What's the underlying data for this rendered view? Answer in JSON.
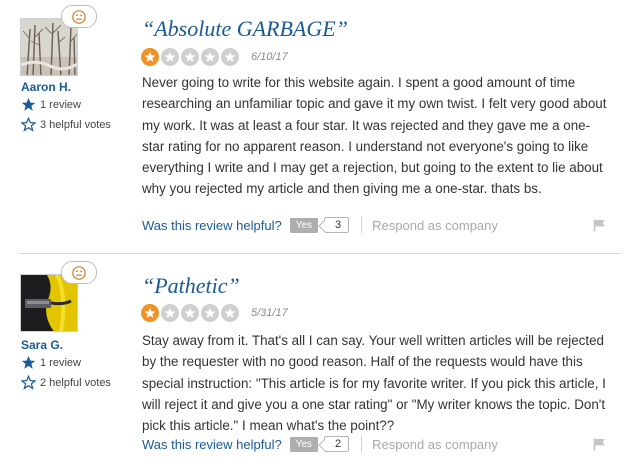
{
  "reviews": [
    {
      "user": {
        "name": "Aaron H.",
        "review_count": "1 review",
        "helpful_votes": "3 helpful votes"
      },
      "mood_icon": "frown-face-icon",
      "title": "“Absolute GARBAGE”",
      "rating": 1,
      "rating_max": 5,
      "date": "6/10/17",
      "body": "Never going to write for this website again. I spent a good amount of time researching an unfamiliar topic and gave it my own twist. I felt very good about my work. It was at least a four star. It was rejected and they gave me a one-star rating for no apparent reason. I understand not everyone's going to like everything I write and I may get a rejection, but going to the extent to lie about why you rejected my article and then giving me a one-star. thats bs.",
      "helpful_question": "Was this review helpful?",
      "yes_label": "Yes",
      "helpful_count": "3",
      "respond_label": "Respond as company"
    },
    {
      "user": {
        "name": "Sara G.",
        "review_count": "1 review",
        "helpful_votes": "2 helpful votes"
      },
      "mood_icon": "frown-face-icon",
      "title": "“Pathetic”",
      "rating": 1,
      "rating_max": 5,
      "date": "5/31/17",
      "body": "Stay away from it. That's all I can say. Your well written articles will be rejected by the requester with no good reason. Half of the requests would have this special instruction: \"This article is for my favorite writer. If you pick this article, I will reject it and give you a one star rating\" or \"My writer knows the topic. Don't pick this article.\" I mean what's the point??",
      "helpful_question": "Was this review helpful?",
      "yes_label": "Yes",
      "helpful_count": "2",
      "respond_label": "Respond as company"
    }
  ],
  "colors": {
    "link_blue": "#1a5a96",
    "star_on": "#f19226",
    "star_off": "#cfcfcf",
    "muted_gray": "#a9a9a9"
  }
}
